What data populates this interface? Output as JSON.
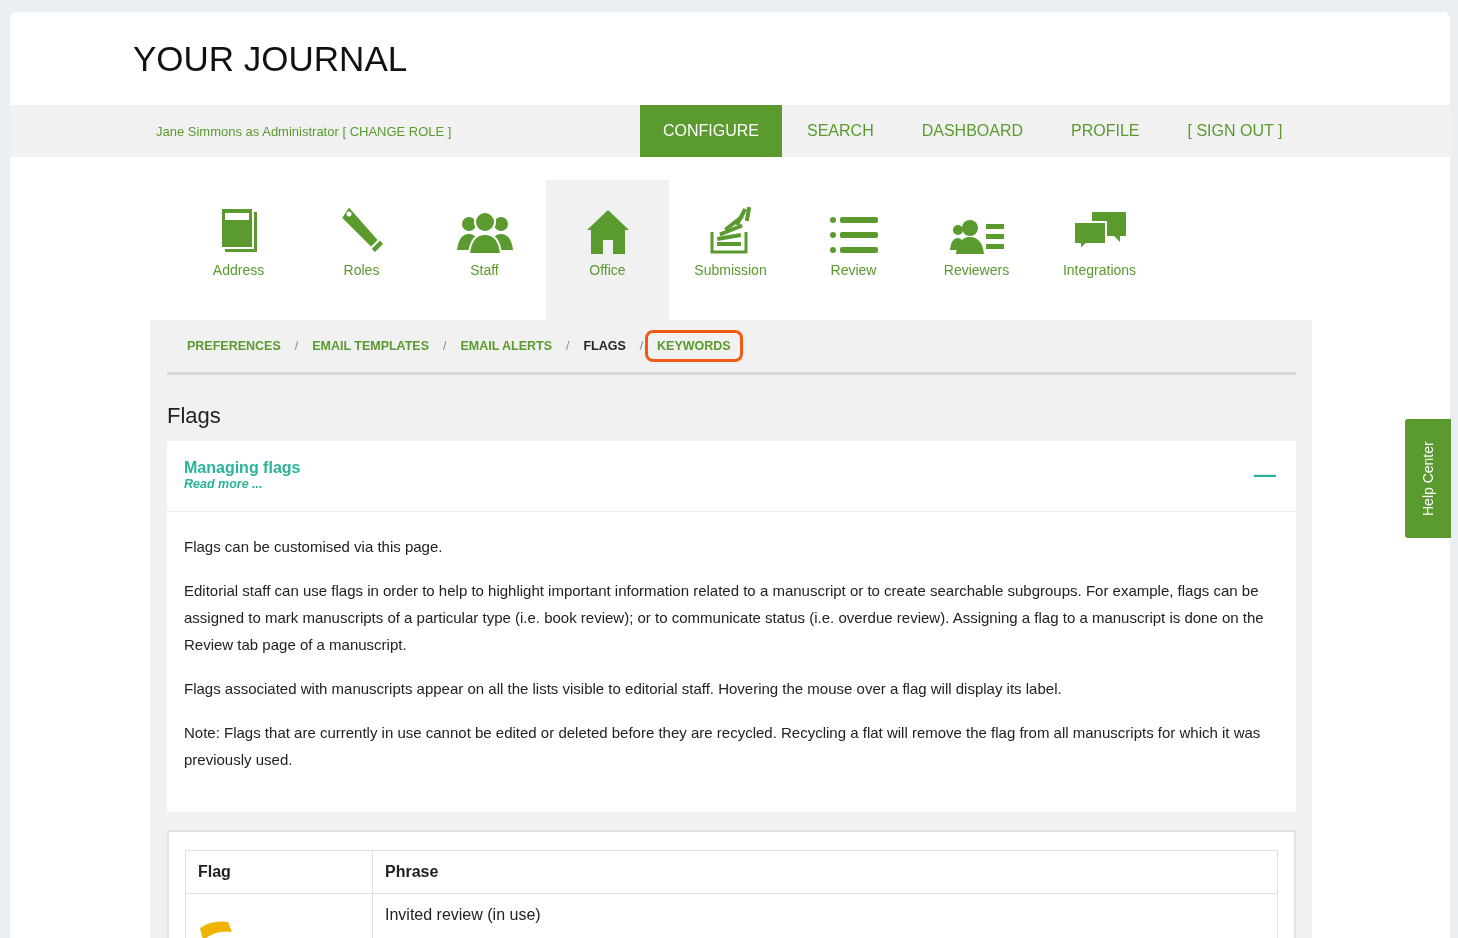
{
  "header": {
    "title": "YOUR JOURNAL"
  },
  "user_bar": {
    "user": "Jane Simmons as Administrator [ CHANGE ROLE ]"
  },
  "nav": [
    {
      "label": "CONFIGURE",
      "selected": true
    },
    {
      "label": "SEARCH",
      "selected": false
    },
    {
      "label": "DASHBOARD",
      "selected": false
    },
    {
      "label": "PROFILE",
      "selected": false
    },
    {
      "label": "[ SIGN OUT ]",
      "selected": false
    }
  ],
  "sections": [
    {
      "label": "Address",
      "kind": "book",
      "selected": false
    },
    {
      "label": "Roles",
      "kind": "tags",
      "selected": false
    },
    {
      "label": "Staff",
      "kind": "people",
      "selected": false
    },
    {
      "label": "Office",
      "kind": "house",
      "selected": true
    },
    {
      "label": "Submission",
      "kind": "tray",
      "selected": false
    },
    {
      "label": "Review",
      "kind": "list",
      "selected": false
    },
    {
      "label": "Reviewers",
      "kind": "card",
      "selected": false
    },
    {
      "label": "Integrations",
      "kind": "chat",
      "selected": false
    }
  ],
  "breadcrumbs": [
    {
      "label": "PREFERENCES",
      "selected": false,
      "highlighted": false
    },
    {
      "label": "EMAIL TEMPLATES",
      "selected": false,
      "highlighted": false
    },
    {
      "label": "EMAIL ALERTS",
      "selected": false,
      "highlighted": false
    },
    {
      "label": "FLAGS",
      "selected": true,
      "highlighted": false
    },
    {
      "label": "KEYWORDS",
      "selected": false,
      "highlighted": true
    }
  ],
  "breadcrumb_separator": "/",
  "page_title": "Flags",
  "info": {
    "title": "Managing flags",
    "link": "Read more ...",
    "expanded": true,
    "collapse_icon": "—",
    "paragraphs": [
      "Flags can be customised via this page.",
      "Editorial staff can use flags in order to help to highlight important information related to a manuscript or to create searchable subgroups. For example, flags can be assigned to mark manuscripts of a particular type (i.e. book review); or to communicate status (i.e. overdue review). Assigning a flag to a manuscript is done on the Review tab page of a manuscript.",
      "Flags associated with manuscripts appear on all the lists visible to editorial staff. Hovering the mouse over a flag will display its label.",
      "Note: Flags that are currently in use cannot be edited or deleted before they are recycled. Recycling a flat will remove the flag from all manuscripts for which it was previously used."
    ]
  },
  "table": {
    "columns": [
      "Flag",
      "Phrase"
    ],
    "rows": [
      {
        "color": "#f0b400",
        "phrase": "Invited review (in use)"
      }
    ]
  },
  "help_tab": "Help Center"
}
